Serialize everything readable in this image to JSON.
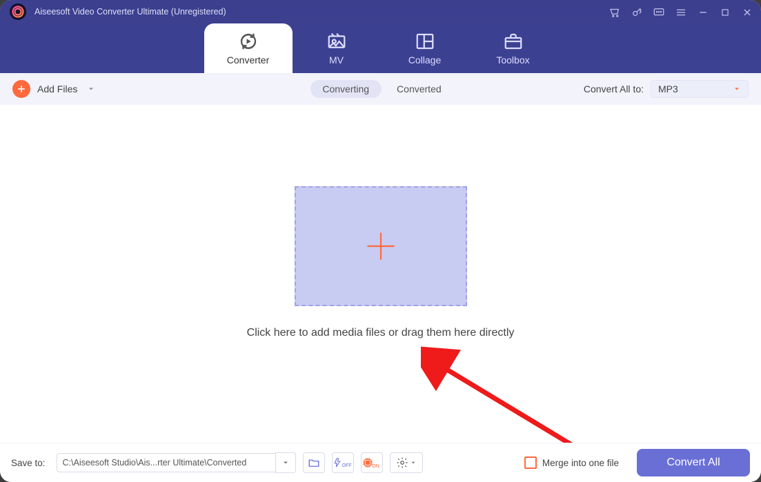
{
  "title": "Aiseesoft Video Converter Ultimate (Unregistered)",
  "mainTabs": {
    "converter": "Converter",
    "mv": "MV",
    "collage": "Collage",
    "toolbox": "Toolbox"
  },
  "toolbar": {
    "addFiles": "Add Files",
    "segConverting": "Converting",
    "segConverted": "Converted",
    "convertAllLabel": "Convert All to:",
    "format": "MP3"
  },
  "dropzone": {
    "hint": "Click here to add media files or drag them here directly"
  },
  "bottombar": {
    "saveToLabel": "Save to:",
    "savePath": "C:\\Aiseesoft Studio\\Ais...rter Ultimate\\Converted",
    "mergeLabel": "Merge into one file",
    "convertBtn": "Convert All"
  }
}
